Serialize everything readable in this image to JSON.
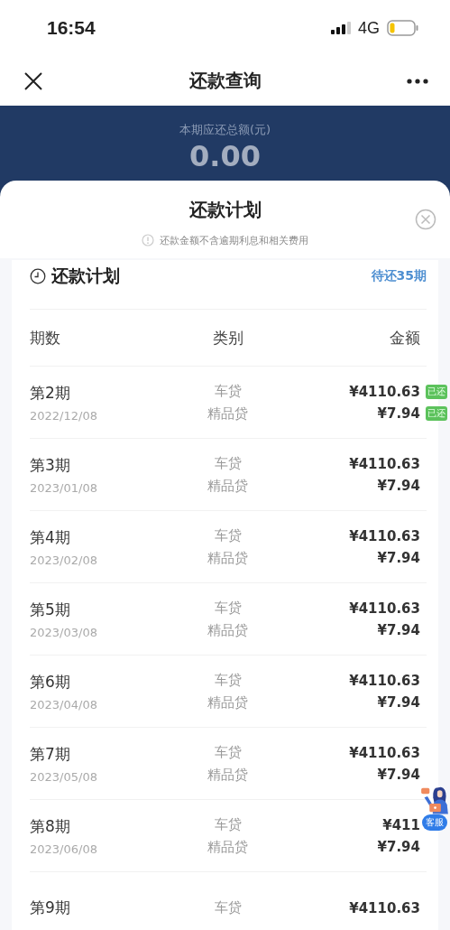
{
  "status_bar": {
    "time": "16:54",
    "network": "4G"
  },
  "nav": {
    "title": "还款查询"
  },
  "summary": {
    "label": "本期应还总额(元)",
    "amount": "0.00"
  },
  "sheet": {
    "title": "还款计划",
    "note": "还款金额不含逾期利息和相关费用"
  },
  "plan": {
    "title": "还款计划",
    "remaining": "待还35期",
    "columns": [
      "期数",
      "类别",
      "金额"
    ],
    "rows": [
      {
        "period": "第2期",
        "date": "2022/12/08",
        "lines": [
          {
            "category": "车贷",
            "amount": "¥4110.63",
            "paid_badge": "已还"
          },
          {
            "category": "精品贷",
            "amount": "¥7.94",
            "paid_badge": "已还"
          }
        ]
      },
      {
        "period": "第3期",
        "date": "2023/01/08",
        "lines": [
          {
            "category": "车贷",
            "amount": "¥4110.63"
          },
          {
            "category": "精品贷",
            "amount": "¥7.94"
          }
        ]
      },
      {
        "period": "第4期",
        "date": "2023/02/08",
        "lines": [
          {
            "category": "车贷",
            "amount": "¥4110.63"
          },
          {
            "category": "精品贷",
            "amount": "¥7.94"
          }
        ]
      },
      {
        "period": "第5期",
        "date": "2023/03/08",
        "lines": [
          {
            "category": "车贷",
            "amount": "¥4110.63"
          },
          {
            "category": "精品贷",
            "amount": "¥7.94"
          }
        ]
      },
      {
        "period": "第6期",
        "date": "2023/04/08",
        "lines": [
          {
            "category": "车贷",
            "amount": "¥4110.63"
          },
          {
            "category": "精品贷",
            "amount": "¥7.94"
          }
        ]
      },
      {
        "period": "第7期",
        "date": "2023/05/08",
        "lines": [
          {
            "category": "车贷",
            "amount": "¥4110.63"
          },
          {
            "category": "精品贷",
            "amount": "¥7.94"
          }
        ]
      },
      {
        "period": "第8期",
        "date": "2023/06/08",
        "lines": [
          {
            "category": "车贷",
            "amount": "¥411"
          },
          {
            "category": "精品贷",
            "amount": "¥7.94"
          }
        ]
      },
      {
        "period": "第9期",
        "lines": [
          {
            "category": "车贷",
            "amount": "¥4110.63"
          }
        ]
      }
    ]
  },
  "service_button": {
    "label": "客服"
  }
}
